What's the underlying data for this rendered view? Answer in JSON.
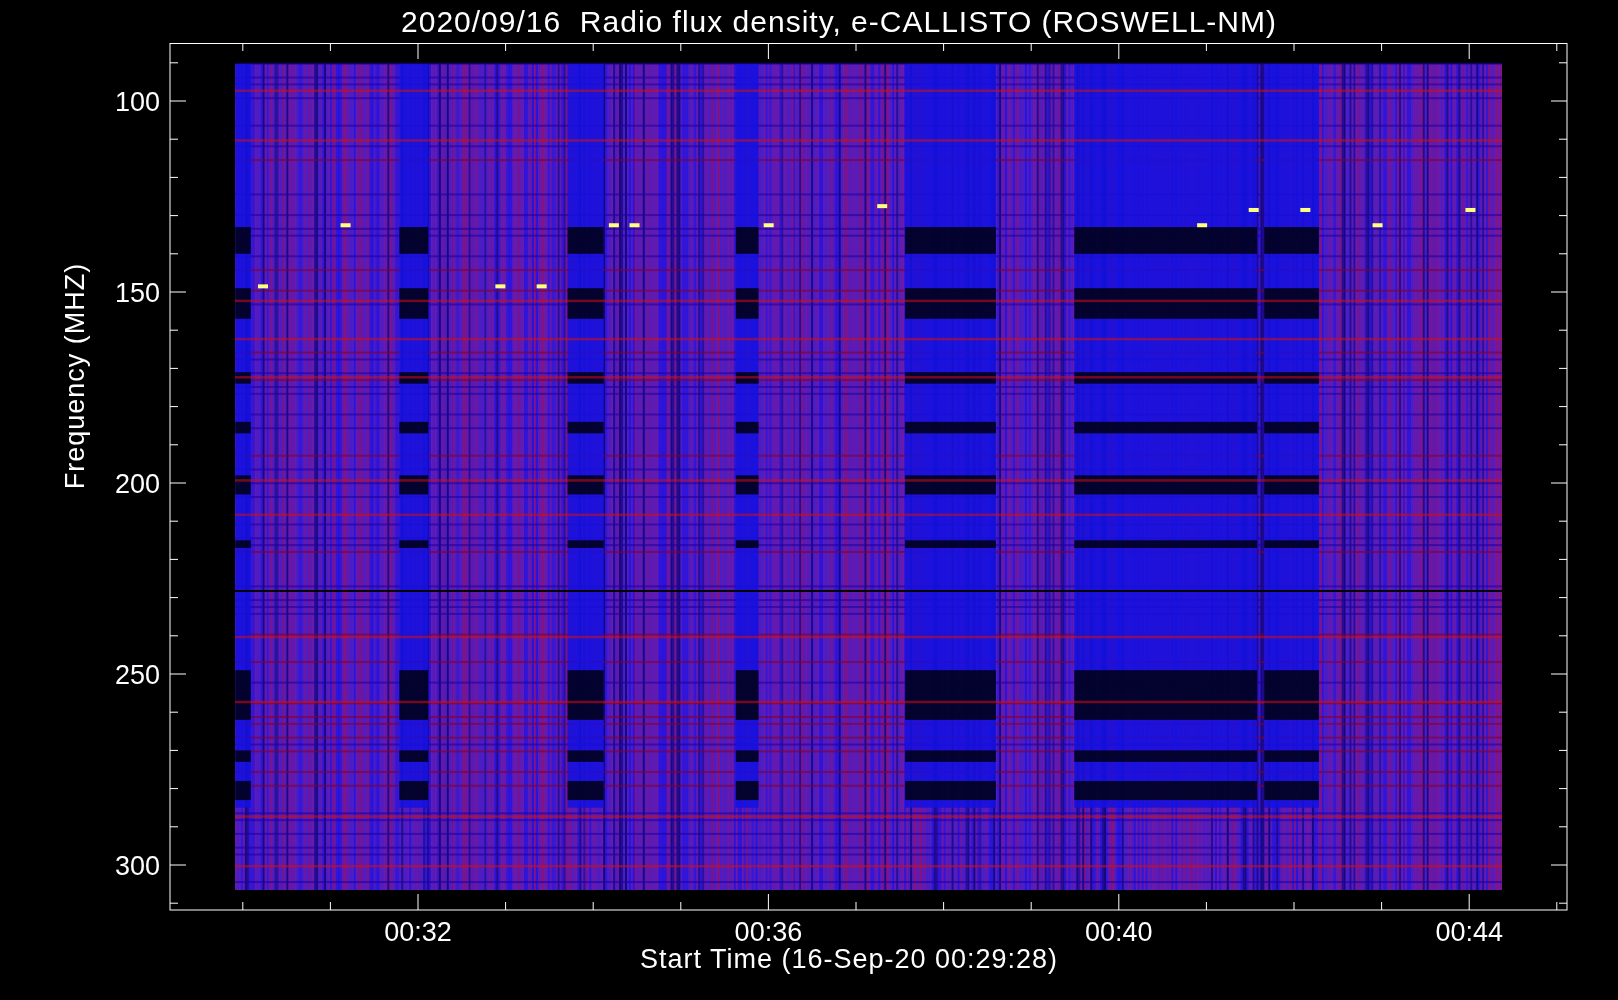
{
  "title": "2020/09/16  Radio flux density, e-CALLISTO (ROSWELL-NM)",
  "y_axis": {
    "label": "Frequency (MHZ)",
    "ticks": [
      "100",
      "150",
      "200",
      "250",
      "300"
    ]
  },
  "x_axis": {
    "label": "Start Time (16-Sep-20 00:29:28)",
    "ticks": [
      "00:32",
      "00:36",
      "00:40",
      "00:44"
    ]
  }
}
